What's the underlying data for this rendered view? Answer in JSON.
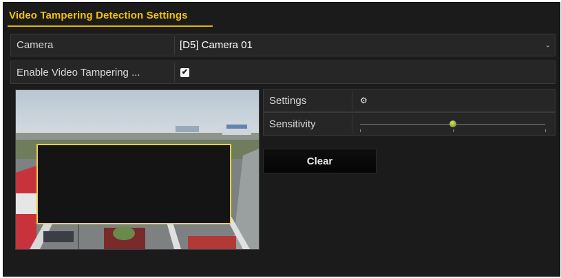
{
  "title": "Video Tampering Detection Settings",
  "camera": {
    "label": "Camera",
    "value": "[D5] Camera 01"
  },
  "enable": {
    "label": "Enable Video Tampering ...",
    "checked": true
  },
  "settings": {
    "label": "Settings"
  },
  "sensitivity": {
    "label": "Sensitivity",
    "level": 0.5
  },
  "clear_button": {
    "label": "Clear"
  },
  "colors": {
    "accent": "#f2c200",
    "tamper_box": "#e3d24a",
    "slider_thumb": "#8fb52a"
  }
}
